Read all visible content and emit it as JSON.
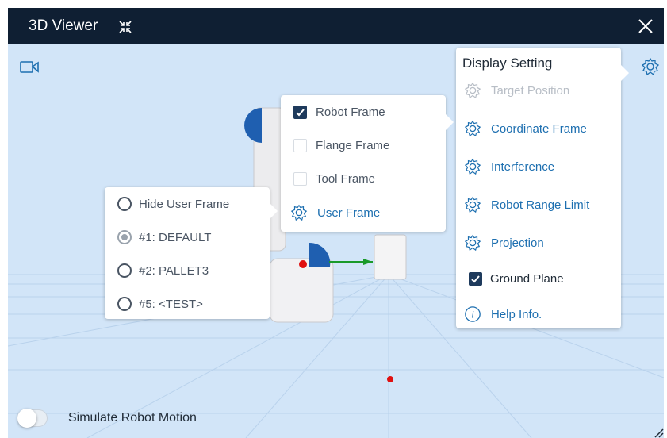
{
  "window": {
    "title": "3D Viewer"
  },
  "icons": {
    "collapse": "collapse-arrows-icon",
    "close": "close-icon",
    "camera": "video-camera-icon",
    "settings": "gear-icon",
    "info": "info-icon",
    "check": "checkmark-icon"
  },
  "colors": {
    "titlebar": "#0f1f33",
    "accent": "#1d6fb0",
    "viewport_bg": "#d2e5f8",
    "disabled": "#b8bec6"
  },
  "display_setting": {
    "title": "Display Setting",
    "items": [
      {
        "label": "Target Position",
        "enabled": false
      },
      {
        "label": "Coordinate Frame",
        "enabled": true
      },
      {
        "label": "Interference",
        "enabled": true
      },
      {
        "label": "Robot Range Limit",
        "enabled": true
      },
      {
        "label": "Projection",
        "enabled": true
      }
    ],
    "ground_plane": {
      "label": "Ground Plane",
      "checked": true
    },
    "help": {
      "label": "Help Info."
    }
  },
  "coordinate_frame": {
    "items": [
      {
        "label": "Robot Frame",
        "checked": true
      },
      {
        "label": "Flange Frame",
        "checked": false
      },
      {
        "label": "Tool Frame",
        "checked": false
      }
    ],
    "user_frame": {
      "label": "User Frame"
    }
  },
  "user_frame": {
    "options": [
      {
        "label": "Hide User Frame",
        "selected": false
      },
      {
        "label": "#1: DEFAULT",
        "selected": true
      },
      {
        "label": "#2: PALLET3",
        "selected": false
      },
      {
        "label": "#5: <TEST>",
        "selected": false
      }
    ]
  },
  "footer": {
    "simulate_label": "Simulate Robot Motion",
    "simulate_on": false
  }
}
